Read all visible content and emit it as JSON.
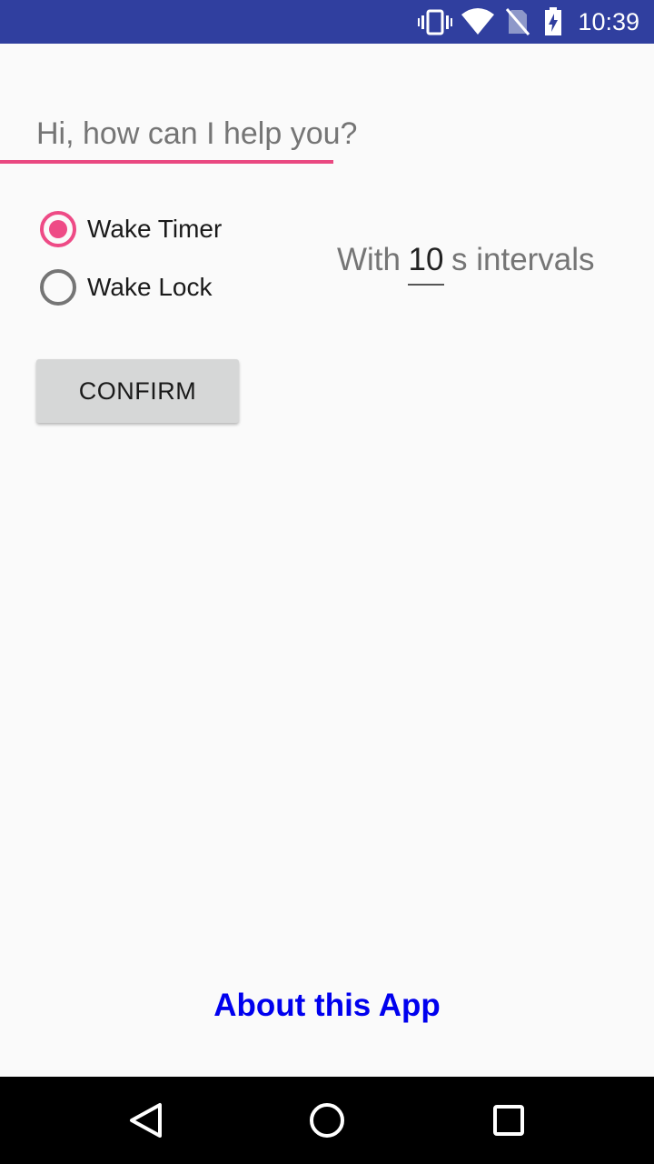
{
  "status_bar": {
    "time": "10:39",
    "icons": [
      "vibrate-icon",
      "wifi-icon",
      "no-sim-icon",
      "battery-charging-icon"
    ],
    "background": "#303f9f"
  },
  "greeting": {
    "placeholder": "Hi, how can I help you?",
    "value": "",
    "accent_color": "#e94880"
  },
  "mode": {
    "options": [
      {
        "label": "Wake Timer",
        "selected": true
      },
      {
        "label": "Wake Lock",
        "selected": false
      }
    ],
    "accent_color": "#ee4b86"
  },
  "interval": {
    "prefix": "With",
    "value": "10",
    "suffix": "s intervals"
  },
  "confirm": {
    "label": "CONFIRM"
  },
  "about": {
    "label": "About this App",
    "color": "#0000ee"
  },
  "nav_bar": {
    "icons": [
      "back-icon",
      "home-icon",
      "recents-icon"
    ]
  }
}
